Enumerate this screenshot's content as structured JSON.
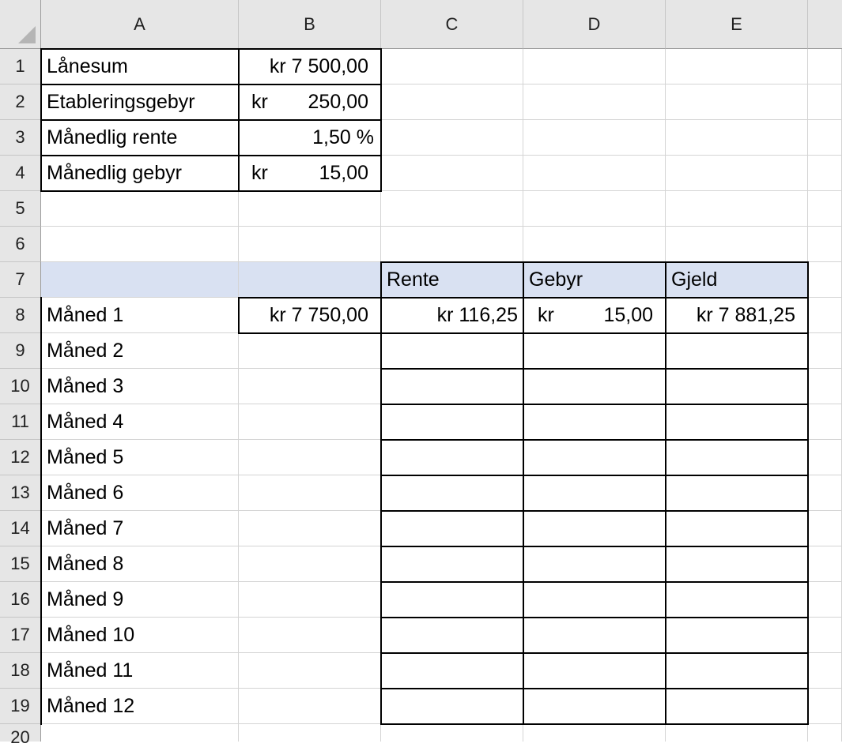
{
  "columns": [
    "A",
    "B",
    "C",
    "D",
    "E"
  ],
  "rows": [
    "1",
    "2",
    "3",
    "4",
    "5",
    "6",
    "7",
    "8",
    "9",
    "10",
    "11",
    "12",
    "13",
    "14",
    "15",
    "16",
    "17",
    "18",
    "19",
    "20"
  ],
  "inputs": {
    "r1": {
      "label": "Lånesum",
      "value": "kr 7 500,00"
    },
    "r2": {
      "label": "Etableringsgebyr",
      "currency": "kr",
      "amount": "250,00"
    },
    "r3": {
      "label": "Månedlig rente",
      "value": "1,50 %"
    },
    "r4": {
      "label": "Månedlig gebyr",
      "currency": "kr",
      "amount": "15,00"
    }
  },
  "table": {
    "headers": {
      "c": "Rente",
      "d": "Gebyr",
      "e": "Gjeld"
    },
    "month1": {
      "b": "kr 7 750,00",
      "c": "kr 116,25",
      "d_currency": "kr",
      "d_amount": "15,00",
      "e": "kr 7 881,25"
    },
    "months": [
      "Måned 1",
      "Måned 2",
      "Måned 3",
      "Måned 4",
      "Måned 5",
      "Måned 6",
      "Måned 7",
      "Måned 8",
      "Måned 9",
      "Måned 10",
      "Måned 11",
      "Måned 12"
    ]
  },
  "colors": {
    "header_fill": "#d9e1f2",
    "gridline": "#d4d4d4",
    "border": "#000000"
  }
}
